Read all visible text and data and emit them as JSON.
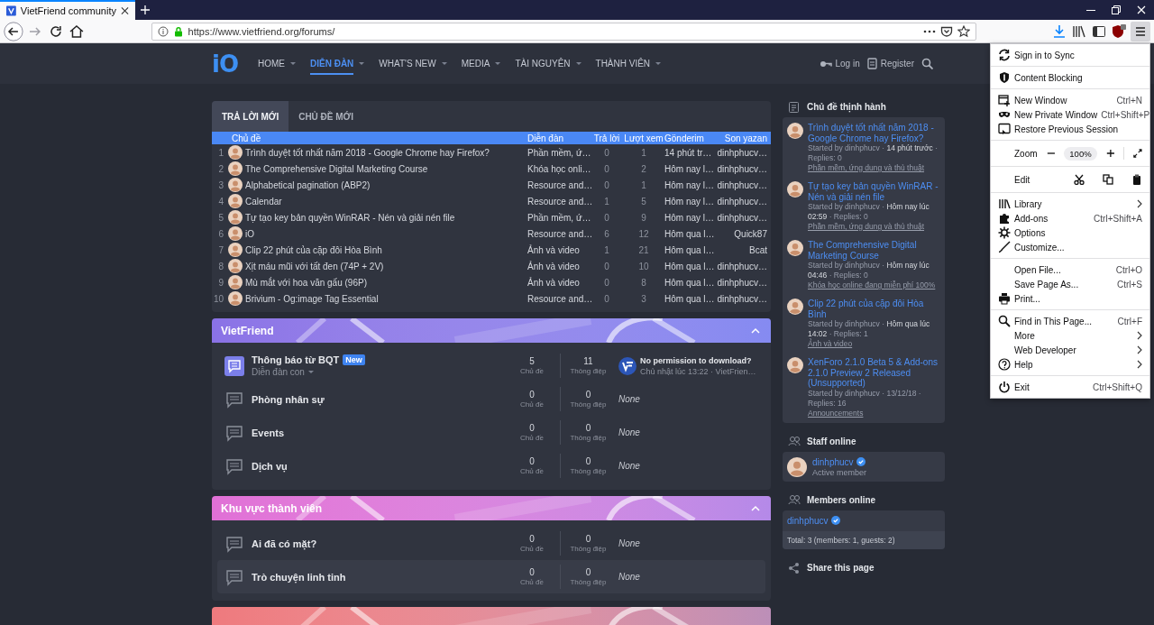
{
  "browser": {
    "tab": {
      "title": "VietFriend community"
    },
    "url": "https://www.vietfriend.org/forums/"
  },
  "site": {
    "logo": "iO",
    "nav": [
      {
        "label": "HOME",
        "selected": false
      },
      {
        "label": "DIỄN ĐÀN",
        "selected": true
      },
      {
        "label": "WHAT'S NEW",
        "selected": false
      },
      {
        "label": "MEDIA",
        "selected": false
      },
      {
        "label": "TÀI NGUYÊN",
        "selected": false
      },
      {
        "label": "THÀNH VIÊN",
        "selected": false
      }
    ],
    "login": "Log in",
    "register": "Register"
  },
  "latest": {
    "tabs": [
      {
        "label": "TRẢ LỜI MỚI",
        "selected": true
      },
      {
        "label": "CHỦ ĐỀ MỚI",
        "selected": false
      }
    ],
    "columns": [
      "Chủ đề",
      "Diễn đàn",
      "Trả lời",
      "Lượt xem",
      "Gönderim",
      "Son yazan"
    ],
    "rows": [
      {
        "index": "1",
        "title": "Trình duyệt tốt nhất năm 2018 - Google Chrome hay Firefox?",
        "forum": "Phần mềm, ứ…",
        "replies": "0",
        "views": "1",
        "date": "14 phút tr…",
        "author": "dinhphucv…"
      },
      {
        "index": "2",
        "title": "The Comprehensive Digital Marketing Course",
        "forum": "Khóa học onli…",
        "replies": "0",
        "views": "2",
        "date": "Hôm nay l…",
        "author": "dinhphucv…"
      },
      {
        "index": "3",
        "title": "Alphabetical pagination (ABP2)",
        "forum": "Resource and…",
        "replies": "0",
        "views": "1",
        "date": "Hôm nay l…",
        "author": "dinhphucv…"
      },
      {
        "index": "4",
        "title": "Calendar",
        "forum": "Resource and…",
        "replies": "1",
        "views": "5",
        "date": "Hôm nay l…",
        "author": "dinhphucv…"
      },
      {
        "index": "5",
        "title": "Tự tạo key bản quyền WinRAR - Nén và giải nén file",
        "forum": "Phần mềm, ứ…",
        "replies": "0",
        "views": "9",
        "date": "Hôm nay l…",
        "author": "dinhphucv…"
      },
      {
        "index": "6",
        "title": "iO",
        "forum": "Resource and…",
        "replies": "6",
        "views": "12",
        "date": "Hôm qua l…",
        "author": "Quick87"
      },
      {
        "index": "7",
        "title": "Clip 22 phút của cặp đôi Hòa Bình",
        "forum": "Ảnh và video",
        "replies": "1",
        "views": "21",
        "date": "Hôm qua l…",
        "author": "Bcat"
      },
      {
        "index": "8",
        "title": "Xịt máu mũi với tất đen (74P + 2V)",
        "forum": "Ảnh và video",
        "replies": "0",
        "views": "10",
        "date": "Hôm qua l…",
        "author": "dinhphucv…"
      },
      {
        "index": "9",
        "title": "Mù mắt với hoa văn gấu (96P)",
        "forum": "Ảnh và video",
        "replies": "0",
        "views": "8",
        "date": "Hôm qua l…",
        "author": "dinhphucv…"
      },
      {
        "index": "10",
        "title": "Brivium - Og:image Tag Essential",
        "forum": "Resource and…",
        "replies": "0",
        "views": "3",
        "date": "Hôm qua l…",
        "author": "dinhphucv…"
      }
    ]
  },
  "categories": [
    {
      "title": "VietFriend",
      "color": "#8a72e6",
      "nodes": [
        {
          "title": "Thông báo từ BQT",
          "badge": "New",
          "subforums": "Diễn đàn con",
          "unread": true,
          "highlighted": false,
          "threads": "5",
          "threads_label": "Chủ đề",
          "messages": "11",
          "messages_label": "Thông điệp",
          "latest": {
            "title": "No permission to download?",
            "meta": "Chủ nhật lúc 13:22 · VietFrien…"
          }
        },
        {
          "title": "Phòng nhân sự",
          "unread": false,
          "highlighted": false,
          "threads": "0",
          "threads_label": "Chủ đề",
          "messages": "0",
          "messages_label": "Thông điệp",
          "latest_none": "None"
        },
        {
          "title": "Events",
          "unread": false,
          "highlighted": false,
          "threads": "0",
          "threads_label": "Chủ đề",
          "messages": "0",
          "messages_label": "Thông điệp",
          "latest_none": "None"
        },
        {
          "title": "Dịch vụ",
          "unread": false,
          "highlighted": false,
          "threads": "0",
          "threads_label": "Chủ đề",
          "messages": "0",
          "messages_label": "Thông điệp",
          "latest_none": "None"
        }
      ]
    },
    {
      "title": "Khu vực thành viên",
      "color": "#e070d6",
      "nodes": [
        {
          "title": "Ai đã có mặt?",
          "unread": false,
          "highlighted": false,
          "threads": "0",
          "threads_label": "Chủ đề",
          "messages": "0",
          "messages_label": "Thông điệp",
          "latest_none": "None"
        },
        {
          "title": "Trò chuyện linh tinh",
          "unread": false,
          "highlighted": true,
          "threads": "0",
          "threads_label": "Chủ đề",
          "messages": "0",
          "messages_label": "Thông điệp",
          "latest_none": "None"
        }
      ]
    },
    {
      "color": "#ee7a7e"
    }
  ],
  "sidebar": {
    "trending": {
      "title": "Chủ đề thịnh hành",
      "threads": [
        {
          "title": "Trình duyệt tốt nhất năm 2018 - Google Chrome hay Firefox?",
          "meta": "Started by dinhphucv · **14 phút trước** · Replies: 0",
          "forum": "Phần mềm, ứng dụng và thủ thuật"
        },
        {
          "title": "Tự tạo key bản quyền WinRAR - Nén và giải nén file",
          "meta": "Started by dinhphucv · **Hôm nay lúc 02:59** · Replies: 0",
          "forum": "Phần mềm, ứng dụng và thủ thuật"
        },
        {
          "title": "The Comprehensive Digital Marketing Course",
          "meta": "Started by dinhphucv · **Hôm nay lúc 04:46** · Replies: 0",
          "forum": "Khóa học online đang miễn phí 100%"
        },
        {
          "title": "Clip 22 phút của cặp đôi Hòa Bình",
          "meta": "Started by dinhphucv · **Hôm qua lúc 14:02** · Replies: 1",
          "forum": "Ảnh và video"
        },
        {
          "title": "XenForo 2.1.0 Beta 5 & Add-ons 2.1.0 Preview 2 Released (Unsupported)",
          "meta": "Started by dinhphucv · 13/12/18 · Replies: 16",
          "forum": "Announcements"
        }
      ]
    },
    "staff": {
      "title": "Staff online",
      "members": [
        {
          "name": "dinhphucv",
          "role": "Active member"
        }
      ]
    },
    "members": {
      "title": "Members online",
      "members": [
        {
          "name": "dinhphucv"
        }
      ],
      "total": "Total: 3 (members: 1, guests: 2)"
    },
    "share": {
      "title": "Share this page"
    }
  },
  "menu": {
    "items": [
      {
        "kind": "item",
        "label": "Sign in to Sync"
      },
      {
        "kind": "separator"
      },
      {
        "kind": "item",
        "label": "Content Blocking"
      },
      {
        "kind": "separator"
      },
      {
        "kind": "item",
        "label": "New Window",
        "shortcut": "Ctrl+N"
      },
      {
        "kind": "item",
        "label": "New Private Window",
        "shortcut": "Ctrl+Shift+P"
      },
      {
        "kind": "item",
        "label": "Restore Previous Session"
      },
      {
        "kind": "separator"
      },
      {
        "kind": "zoom",
        "label": "Zoom",
        "value": "100%"
      },
      {
        "kind": "separator"
      },
      {
        "kind": "edit",
        "label": "Edit"
      },
      {
        "kind": "separator"
      },
      {
        "kind": "item",
        "label": "Library",
        "submenu": true
      },
      {
        "kind": "item",
        "label": "Add-ons",
        "shortcut": "Ctrl+Shift+A"
      },
      {
        "kind": "item",
        "label": "Options"
      },
      {
        "kind": "item",
        "label": "Customize..."
      },
      {
        "kind": "separator"
      },
      {
        "kind": "item",
        "label": "Open File...",
        "shortcut": "Ctrl+O"
      },
      {
        "kind": "item",
        "label": "Save Page As...",
        "shortcut": "Ctrl+S"
      },
      {
        "kind": "item",
        "label": "Print..."
      },
      {
        "kind": "separator"
      },
      {
        "kind": "item",
        "label": "Find in This Page...",
        "shortcut": "Ctrl+F"
      },
      {
        "kind": "item",
        "label": "More",
        "submenu": true
      },
      {
        "kind": "item",
        "label": "Web Developer",
        "submenu": true
      },
      {
        "kind": "item",
        "label": "Help",
        "submenu": true
      },
      {
        "kind": "separator"
      },
      {
        "kind": "item",
        "label": "Exit",
        "shortcut": "Ctrl+Shift+Q"
      }
    ]
  }
}
